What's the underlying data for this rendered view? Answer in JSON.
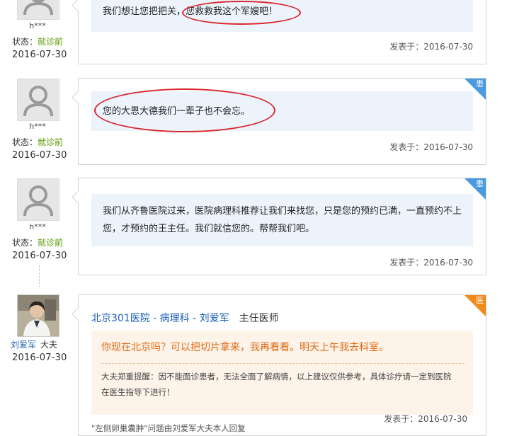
{
  "entries": [
    {
      "user": "h***",
      "status_label": "状态：",
      "status_value": "就诊前",
      "date": "2016-07-30",
      "message": "我们想让您把把关，您救救我这个军嫂吧！",
      "posted_label": "发表于：2016-07-30",
      "badge": ""
    },
    {
      "user": "h***",
      "status_label": "状态：",
      "status_value": "就诊前",
      "date": "2016-07-30",
      "message": "您的大恩大德我们一辈子也不会忘。",
      "posted_label": "发表于：2016-07-30",
      "badge": "患"
    },
    {
      "user": "h***",
      "status_label": "状态：",
      "status_value": "就诊前",
      "date": "2016-07-30",
      "message": "我们从齐鲁医院过来，医院病理科推荐让我们来找您，只是您的预约已满，一直预约不上您，才预约的王主任。我们就信您的。帮帮我们吧。",
      "posted_label": "发表于：2016-07-30",
      "badge": "患"
    }
  ],
  "doctor_entry": {
    "doctor_name": "刘爱军",
    "doctor_role": "大夫",
    "date": "2016-07-30",
    "header_link": "北京301医院 - 病理科 - 刘爱军",
    "header_title": "主任医师",
    "reply": "你现在北京吗？可以把切片拿来，我再看看。明天上午我去科室。",
    "note": "大夫郑重提醒：因不能面诊患者，无法全面了解病情，以上建议仅供参考，具体诊疗请一定到医院在医生指导下进行！",
    "footer": "\"左侧卵巢囊肿\"问题由刘爱军大夫本人回复",
    "posted_label": "发表于：2016-07-30",
    "badge": "医"
  },
  "colors": {
    "patient_badge": "#4a9ae0",
    "doctor_badge": "#f08a1c",
    "highlight_ellipse": "#d9262c",
    "status_green": "#5a9a00",
    "link_blue": "#1a5fb4"
  },
  "icons": {
    "patient_avatar": "default-user-silhouette-icon",
    "doctor_avatar": "doctor-photo"
  }
}
